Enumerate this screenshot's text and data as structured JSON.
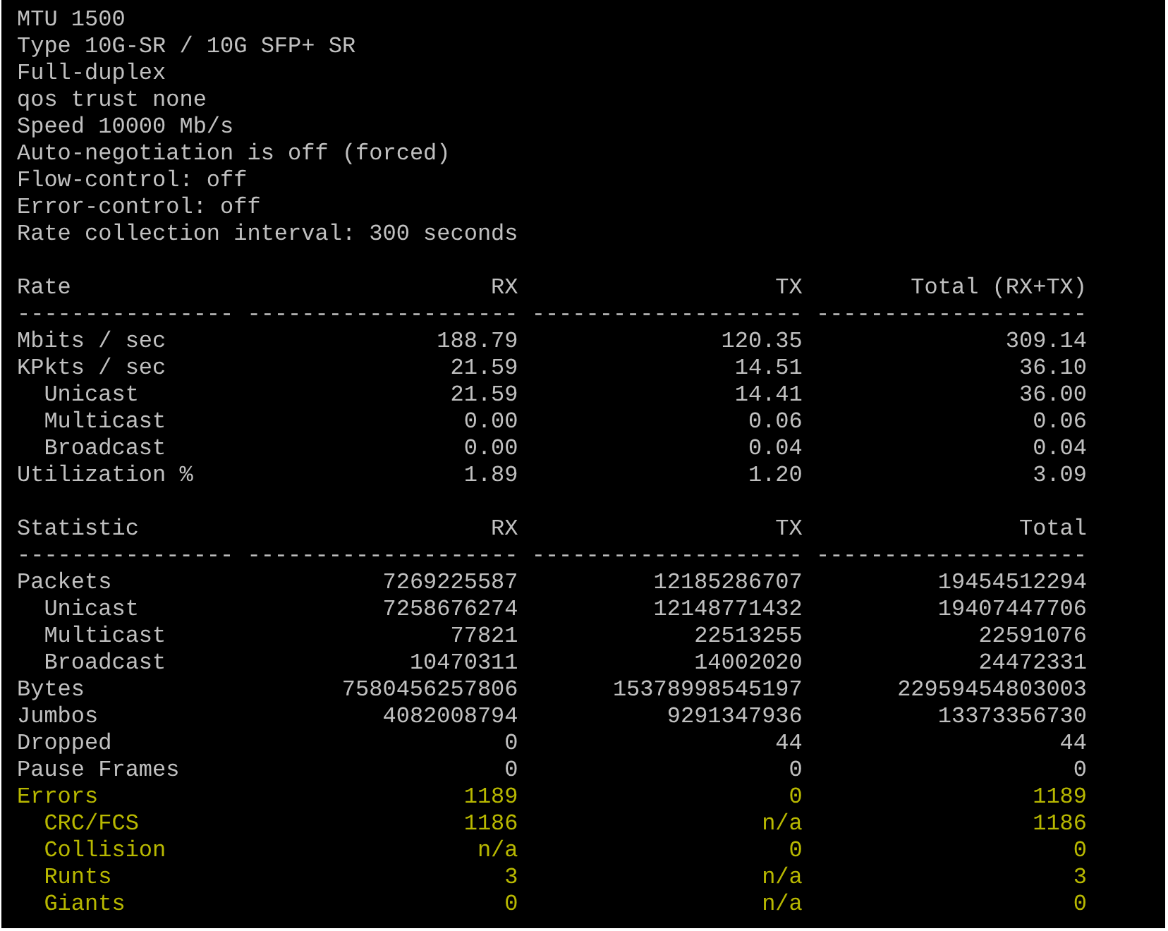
{
  "info_lines": [
    "MTU 1500",
    "Type 10G-SR / 10G SFP+ SR",
    "Full-duplex",
    "qos trust none",
    "Speed 10000 Mb/s",
    "Auto-negotiation is off (forced)",
    "Flow-control: off",
    "Error-control: off",
    "Rate collection interval: 300 seconds"
  ],
  "tables": [
    {
      "columns": [
        "Rate",
        "RX",
        "TX",
        "Total (RX+TX)"
      ],
      "rule": [
        "----------------",
        "--------------------",
        "--------------------",
        "--------------------"
      ],
      "rows": [
        {
          "label": "Mbits / sec",
          "values": [
            "188.79",
            "120.35",
            "309.14"
          ],
          "kind": "normal"
        },
        {
          "label": "KPkts / sec",
          "values": [
            "21.59",
            "14.51",
            "36.10"
          ],
          "kind": "normal",
          "children": [
            {
              "label": "Unicast",
              "values": [
                "21.59",
                "14.41",
                "36.00"
              ],
              "kind": "normal"
            },
            {
              "label": "Multicast",
              "values": [
                "0.00",
                "0.06",
                "0.06"
              ],
              "kind": "normal"
            },
            {
              "label": "Broadcast",
              "values": [
                "0.00",
                "0.04",
                "0.04"
              ],
              "kind": "normal"
            }
          ]
        },
        {
          "label": "Utilization %",
          "values": [
            "1.89",
            "1.20",
            "3.09"
          ],
          "kind": "normal"
        }
      ]
    },
    {
      "columns": [
        "Statistic",
        "RX",
        "TX",
        "Total"
      ],
      "rule": [
        "----------------",
        "--------------------",
        "--------------------",
        "--------------------"
      ],
      "rows": [
        {
          "label": "Packets",
          "values": [
            "7269225587",
            "12185286707",
            "19454512294"
          ],
          "kind": "normal",
          "children": [
            {
              "label": "Unicast",
              "values": [
                "7258676274",
                "12148771432",
                "19407447706"
              ],
              "kind": "normal"
            },
            {
              "label": "Multicast",
              "values": [
                "77821",
                "22513255",
                "22591076"
              ],
              "kind": "normal"
            },
            {
              "label": "Broadcast",
              "values": [
                "10470311",
                "14002020",
                "24472331"
              ],
              "kind": "normal"
            }
          ]
        },
        {
          "label": "Bytes",
          "values": [
            "7580456257806",
            "15378998545197",
            "22959454803003"
          ],
          "kind": "normal"
        },
        {
          "label": "Jumbos",
          "values": [
            "4082008794",
            "9291347936",
            "13373356730"
          ],
          "kind": "normal"
        },
        {
          "label": "Dropped",
          "values": [
            "0",
            "44",
            "44"
          ],
          "kind": "normal"
        },
        {
          "label": "Pause Frames",
          "values": [
            "0",
            "0",
            "0"
          ],
          "kind": "normal"
        },
        {
          "label": "Errors",
          "values": [
            "1189",
            "0",
            "1189"
          ],
          "kind": "error",
          "children": [
            {
              "label": "CRC/FCS",
              "values": [
                "1186",
                "n/a",
                "1186"
              ],
              "kind": "error"
            },
            {
              "label": "Collision",
              "values": [
                "n/a",
                "0",
                "0"
              ],
              "kind": "error"
            },
            {
              "label": "Runts",
              "values": [
                "3",
                "n/a",
                "3"
              ],
              "kind": "error"
            },
            {
              "label": "Giants",
              "values": [
                "0",
                "n/a",
                "0"
              ],
              "kind": "error"
            }
          ]
        }
      ]
    }
  ]
}
